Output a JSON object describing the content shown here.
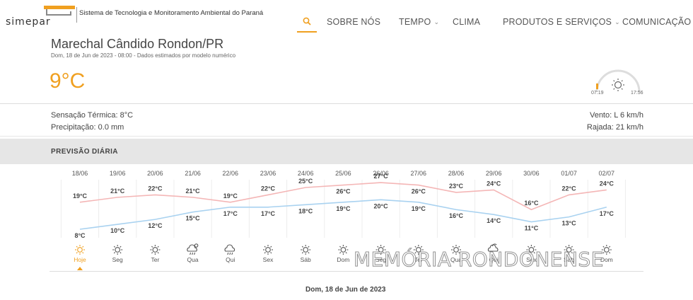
{
  "brand": {
    "logo_text": "simepar",
    "subtitle": "Sistema de Tecnologia e Monitoramento Ambiental do Paraná"
  },
  "nav": {
    "items": [
      {
        "label": "SOBRE NÓS",
        "dropdown": false
      },
      {
        "label": "TEMPO",
        "dropdown": true
      },
      {
        "label": "CLIMA",
        "dropdown": false
      },
      {
        "label": "PRODUTOS E SERVIÇOS",
        "dropdown": true
      },
      {
        "label": "COMUNICAÇÃO",
        "dropdown": true
      }
    ]
  },
  "location": {
    "city": "Marechal Cândido Rondon/PR",
    "datetime_note": "Dom, 18 de Jun de 2023 - 08:00 - Dados estimados por modelo numérico",
    "temperature": "9°C"
  },
  "sun": {
    "sunrise": "07:19",
    "sunset": "17:56"
  },
  "conditions": {
    "feels_like": "Sensação Térmica: 8°C",
    "precipitation": "Precipitação: 0.0 mm",
    "wind": "Vento: L 6 km/h",
    "gust": "Rajada: 21 km/h"
  },
  "forecast": {
    "title": "PREVISÃO DIÁRIA",
    "footer_date": "Dom, 18 de Jun de 2023"
  },
  "chart_data": {
    "type": "line",
    "x": [
      "18/06",
      "19/06",
      "20/06",
      "21/06",
      "22/06",
      "23/06",
      "24/06",
      "25/06",
      "26/06",
      "27/06",
      "28/06",
      "29/06",
      "30/06",
      "01/07",
      "02/07"
    ],
    "days": [
      "Hoje",
      "Seg",
      "Ter",
      "Qua",
      "Qui",
      "Sex",
      "Sáb",
      "Dom",
      "Seg",
      "Ter",
      "Qua",
      "Qui",
      "Sex",
      "Sáb",
      "Dom"
    ],
    "icons": [
      "sun-icon",
      "sun-icon",
      "sun-icon",
      "thunderstorm-icon",
      "rain-icon",
      "sun-icon",
      "sun-icon",
      "sun-icon",
      "sun-icon",
      "sun-icon",
      "sun-icon",
      "partly-cloudy-icon",
      "sun-icon",
      "sun-icon",
      "sun-icon"
    ],
    "series": [
      {
        "values": [
          19,
          21,
          22,
          21,
          19,
          22,
          25,
          26,
          27,
          26,
          23,
          24,
          16,
          22,
          24
        ],
        "color": "#f4b6b6"
      },
      {
        "values": [
          8,
          10,
          12,
          15,
          17,
          17,
          18,
          19,
          20,
          19,
          16,
          14,
          11,
          13,
          17
        ],
        "color": "#a9d2f0"
      }
    ],
    "unit": "°C",
    "highlight_color": "#f0a020"
  },
  "watermark": "MEMÓRIA RONDONENSE"
}
